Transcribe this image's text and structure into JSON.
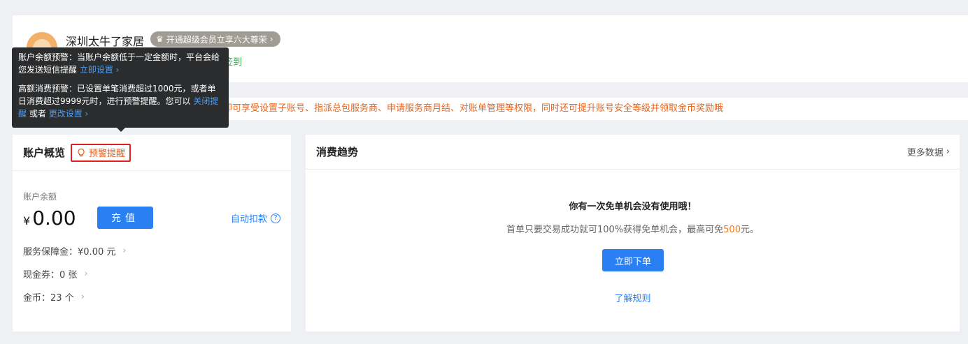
{
  "profile": {
    "shop_name": "深圳太牛了家居",
    "vip_badge": "开通超级会员立享六大尊荣",
    "signin_fragment": "签到"
  },
  "notice": {
    "text": "认证后即可享受设置子账号、指派总包服务商、申请服务商月结、对账单管理等权限，同时还可提升账号安全等级并领取金币奖励哦"
  },
  "tooltip": {
    "balance_alert_text": "账户余额预警：当账户余额低于一定金额时，平台会给您发送短信提醒",
    "balance_alert_link": "立即设置 ›",
    "high_spend_text": "高额消费预警：已设置单笔消费超过1000元，或者单日消费超过9999元时，进行预警提醒。您可以",
    "high_spend_close_link": "关闭提醒",
    "high_spend_or": "或者",
    "high_spend_change_link": "更改设置 ›"
  },
  "account": {
    "title": "账户概览",
    "alert_button": "预警提醒",
    "balance_label": "账户余额",
    "currency": "¥",
    "balance_amount": "0.00",
    "recharge_button": "充值",
    "auto_deduct": "自动扣款",
    "stats": [
      {
        "label": "服务保障金：",
        "value": "¥0.00 元"
      },
      {
        "label": "现金券：",
        "value": "0 张"
      },
      {
        "label": "金币：",
        "value": "23 个"
      }
    ]
  },
  "trend": {
    "title": "消费趋势",
    "more_data": "更多数据",
    "promo_title": "你有一次免单机会没有使用哦！",
    "promo_desc_before": "首单只要交易成功就可100%获得免单机会，最高可免",
    "promo_desc_amount": "500",
    "promo_desc_after": "元。",
    "order_button": "立即下单",
    "rules_link": "了解规则"
  },
  "colors": {
    "primary": "#2a7ff3",
    "warning": "#ee5a13",
    "alert_border": "#e02020",
    "signin_green": "#2db34a"
  }
}
